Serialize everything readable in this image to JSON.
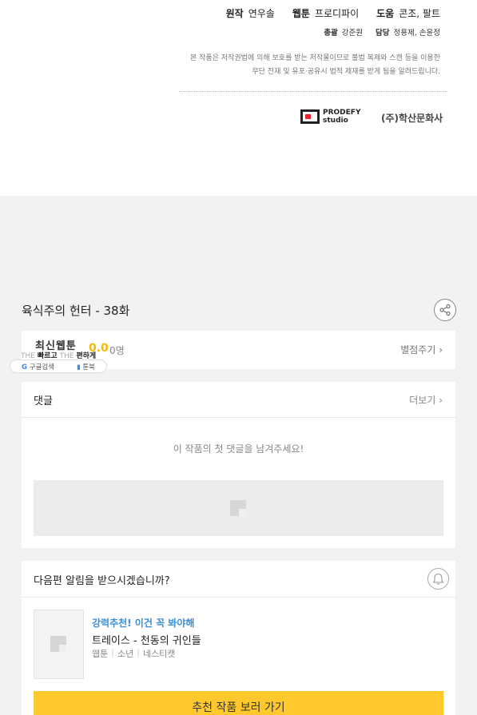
{
  "credits": {
    "original_label": "원작",
    "original_value": "연우솔",
    "webtoon_label": "웹툰",
    "webtoon_value": "프로디파이",
    "help_label": "도움",
    "help_value": "콘조, 팔트",
    "director_label": "총괄",
    "director_value": "강준원",
    "manager_label": "담당",
    "manager_value": "정용제, 손윤정",
    "copyright_line1": "본 작품은 저작권법에 의해 보호를 받는 저작물이므로 불법 복제와 스캔 등을 이용한",
    "copyright_line2": "무단 전재 및 유포·공유시 법적 제재를 받게 됨을 알려드립니다.",
    "logo1_line1": "PRODEFY",
    "logo1_line2": "studio",
    "logo2": "(주)학산문화사"
  },
  "episode": {
    "title": "육식주의 헌터 - 38화"
  },
  "rating": {
    "value": "0.0",
    "count": "0명",
    "rate_link": "별점주기 ›"
  },
  "popup": {
    "title": "최신웹툰",
    "sub_the1": "THE ",
    "sub_fast": "빠르고",
    "sub_the2": " THE ",
    "sub_easy": "편하게",
    "left_item": "구글검색",
    "right_item": "툰북"
  },
  "comments": {
    "title": "댓글",
    "more": "더보기 ›",
    "empty_message": "이 작품의 첫 댓글을 남겨주세요!"
  },
  "next_alert": {
    "title": "다음편 알림을 받으시겠습니까?",
    "rec_label": "강력추천! 이건 꼭 봐야해",
    "rec_title": "트레이스 - 천동의 귀인들",
    "tags": [
      "웹툰",
      "소년",
      "네스티캣"
    ],
    "button": "추천 작품 보러 가기"
  },
  "colors": {
    "rating": "#f5b800",
    "recommend": "#3a8fd9",
    "button": "#ffc82c"
  }
}
